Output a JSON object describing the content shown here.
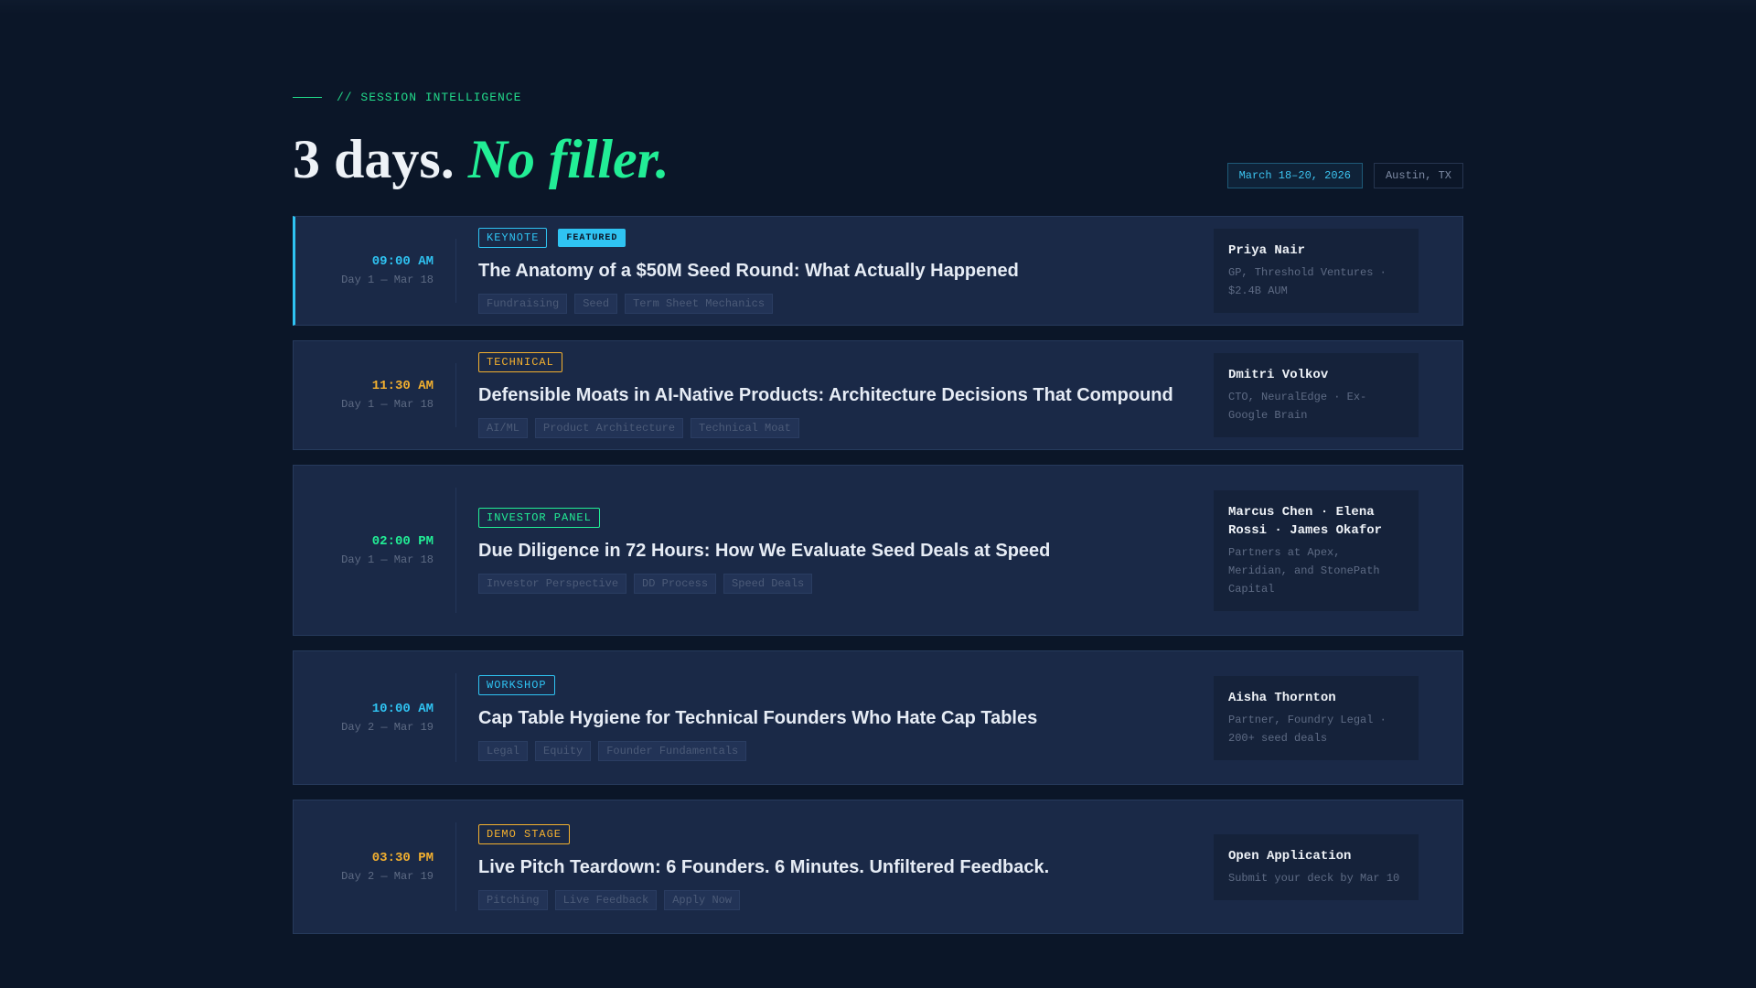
{
  "header": {
    "eyebrow": "// SESSION INTELLIGENCE",
    "title_main": "3 days.",
    "title_accent": "No filler.",
    "date": "March 18–20, 2026",
    "location": "Austin, TX"
  },
  "colors": {
    "cyan": "#2fc3f2",
    "amber": "#f3b02f",
    "green": "#22ee96",
    "background": "#0b1628",
    "card": "#1a2947"
  },
  "sessions": [
    {
      "time": "09:00 AM",
      "day": "Day 1 — Mar 18",
      "type": "KEYNOTE",
      "featured_label": "FEATURED",
      "title": "The Anatomy of a $50M Seed Round: What Actually Happened",
      "tags": [
        "Fundraising",
        "Seed",
        "Term Sheet Mechanics"
      ],
      "speaker_name": "Priya Nair",
      "speaker_role": "GP, Threshold Ventures · $2.4B AUM",
      "accent": "#2fc3f2"
    },
    {
      "time": "11:30 AM",
      "day": "Day 1 — Mar 18",
      "type": "TECHNICAL",
      "title": "Defensible Moats in AI-Native Products: Architecture Decisions That Compound",
      "tags": [
        "AI/ML",
        "Product Architecture",
        "Technical Moat"
      ],
      "speaker_name": "Dmitri Volkov",
      "speaker_role": "CTO, NeuralEdge · Ex-Google Brain",
      "accent": "#f3b02f"
    },
    {
      "time": "02:00 PM",
      "day": "Day 1 — Mar 18",
      "type": "INVESTOR PANEL",
      "title": "Due Diligence in 72 Hours: How We Evaluate Seed Deals at Speed",
      "tags": [
        "Investor Perspective",
        "DD Process",
        "Speed Deals"
      ],
      "speaker_name": "Marcus Chen · Elena Rossi · James Okafor",
      "speaker_role": "Partners at Apex, Meridian, and StonePath Capital",
      "accent": "#22ee96"
    },
    {
      "time": "10:00 AM",
      "day": "Day 2 — Mar 19",
      "type": "WORKSHOP",
      "title": "Cap Table Hygiene for Technical Founders Who Hate Cap Tables",
      "tags": [
        "Legal",
        "Equity",
        "Founder Fundamentals"
      ],
      "speaker_name": "Aisha Thornton",
      "speaker_role": "Partner, Foundry Legal · 200+ seed deals",
      "accent": "#2fc3f2"
    },
    {
      "time": "03:30 PM",
      "day": "Day 2 — Mar 19",
      "type": "DEMO STAGE",
      "title": "Live Pitch Teardown: 6 Founders. 6 Minutes. Unfiltered Feedback.",
      "tags": [
        "Pitching",
        "Live Feedback",
        "Apply Now"
      ],
      "speaker_name": "Open Application",
      "speaker_role": "Submit your deck by Mar 10",
      "accent": "#f3b02f"
    }
  ]
}
